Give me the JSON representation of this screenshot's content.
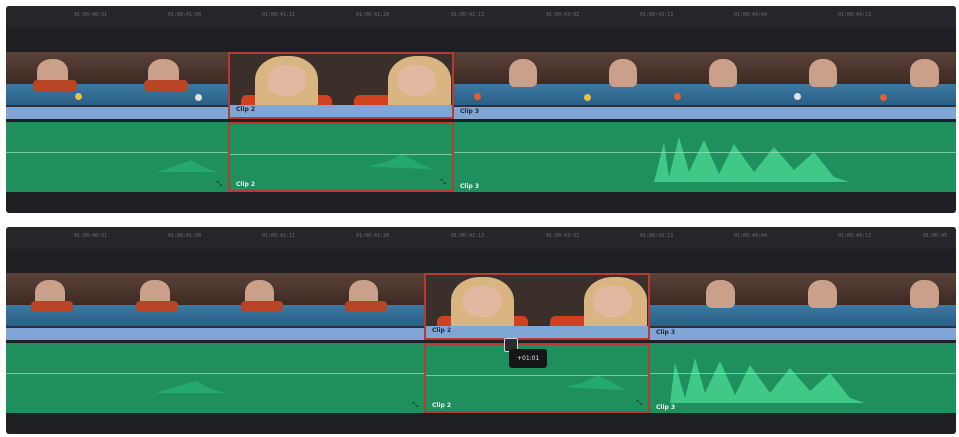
{
  "panels": [
    {
      "ruler_ticks": [
        "01:00:40:51",
        "01:00:41:00",
        "01:00:41:11",
        "01:00:41:20",
        "01:00:42:13",
        "01:00:43:02",
        "01:00:43:13",
        "01:00:44:04",
        "01:00:44:13"
      ],
      "clips": [
        {
          "video_label": "",
          "audio_label": ""
        },
        {
          "video_label": "Clip 2",
          "audio_label": "Clip 2"
        },
        {
          "video_label": "Clip 3",
          "audio_label": "Clip 3"
        }
      ]
    },
    {
      "ruler_ticks": [
        "01:00:40:51",
        "01:00:41:00",
        "01:00:41:11",
        "01:00:41:20",
        "01:00:42:13",
        "01:00:43:02",
        "01:00:43:13",
        "01:00:44:04",
        "01:00:44:13",
        "01:00:45"
      ],
      "clips": [
        {
          "video_label": "",
          "audio_label": ""
        },
        {
          "video_label": "Clip 2",
          "audio_label": "Clip 2"
        },
        {
          "video_label": "Clip 3",
          "audio_label": "Clip 3"
        }
      ],
      "tooltip": "+01:01"
    }
  ],
  "colors": {
    "selected_border": "#b93a30",
    "video_label_bg": "#7fa6d4",
    "audio_clip": "#1f8f5e",
    "timeline_bg": "#1f2023"
  },
  "icons": [
    "keyframe-icon",
    "trim-handle-icon",
    "link-icon"
  ]
}
